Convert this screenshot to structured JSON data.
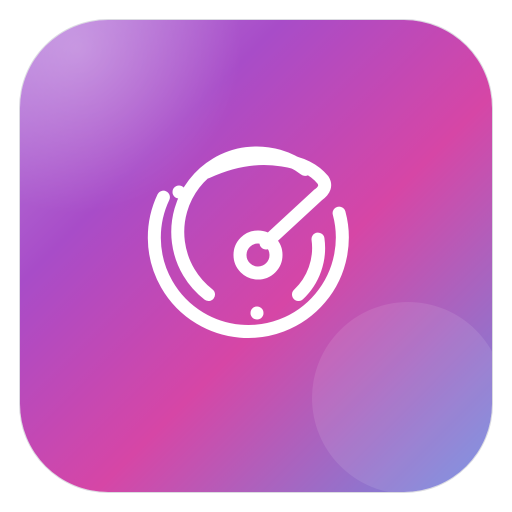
{
  "app": {
    "name": "",
    "icon": "radar-icon"
  },
  "colors": {
    "gradient_top_left": "#b77fdc",
    "gradient_purple": "#a84cc8",
    "gradient_magenta": "#d646a6",
    "gradient_bottom_right": "#6f8ae0",
    "glyph": "#ffffff"
  }
}
